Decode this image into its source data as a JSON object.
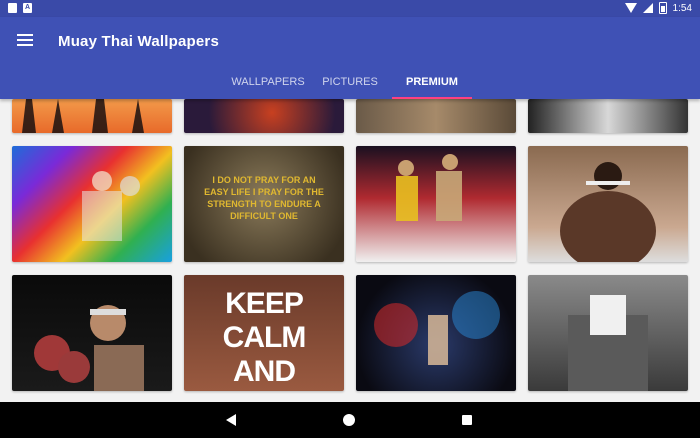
{
  "status_bar": {
    "left_icons": [
      "sd-card-icon",
      "app-notification-icon"
    ],
    "time": "1:54"
  },
  "app_bar": {
    "title": "Muay Thai Wallpapers",
    "menu_icon": "hamburger-menu-icon"
  },
  "tabs": [
    {
      "label": "WALLPAPERS",
      "active": false
    },
    {
      "label": "PICTURES",
      "active": false
    },
    {
      "label": "PREMIUM",
      "active": true
    }
  ],
  "tiles": {
    "row2_tile2_text": "I DO NOT PRAY FOR AN EASY LIFE I PRAY FOR THE STRENGTH TO ENDURE A DIFFICULT ONE",
    "row3_tile2_text": "KEEP CALM AND MUAY"
  },
  "nav_bar": {
    "back_icon": "back-triangle-icon",
    "home_icon": "home-circle-icon",
    "recents_icon": "recents-square-icon"
  },
  "colors": {
    "primary": "#3f51b5",
    "primary_dark": "#3a4aa8",
    "accent": "#ff4081"
  }
}
